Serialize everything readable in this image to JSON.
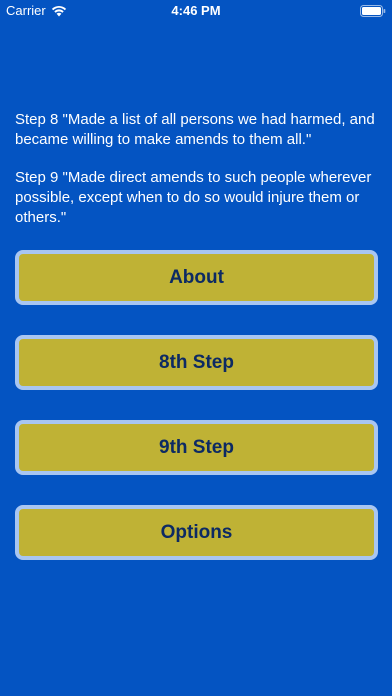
{
  "status_bar": {
    "carrier": "Carrier",
    "time": "4:46 PM",
    "icons": [
      "wifi-icon",
      "battery-icon"
    ]
  },
  "description": {
    "step8": "Step 8 \"Made a list of all persons we had harmed, and became willing to make amends to them all.\"",
    "step9": "Step 9 \"Made direct amends to such people wherever possible, except when to do so would injure them or others.\""
  },
  "buttons": {
    "about": "About",
    "step8": "8th Step",
    "step9": "9th Step",
    "options": "Options"
  },
  "colors": {
    "background": "#0454c2",
    "button_fill": "#bfb235",
    "button_border": "#a8c6f2",
    "button_text": "#0d2a63",
    "text": "#ffffff"
  }
}
